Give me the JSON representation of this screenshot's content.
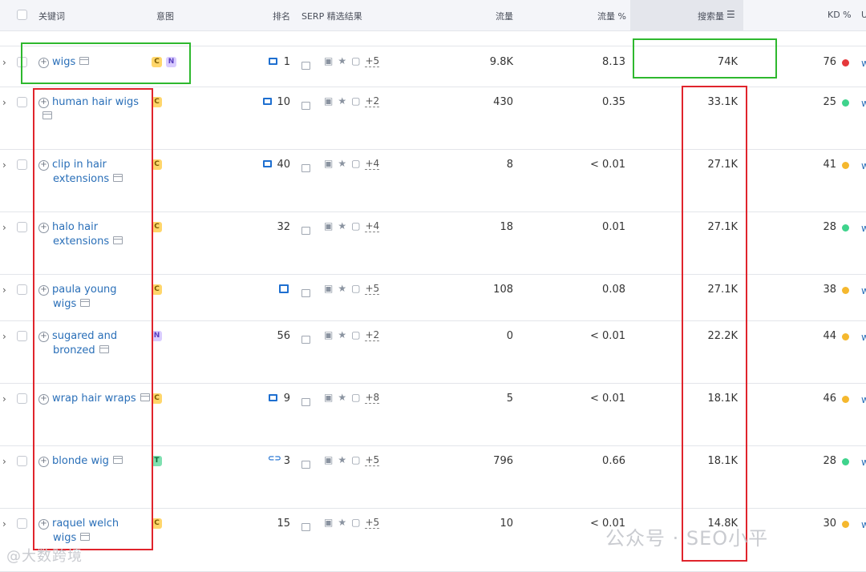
{
  "header": {
    "keyword": "关键词",
    "intent": "意图",
    "rank": "排名",
    "serp": "SERP 精选结果",
    "traffic": "流量",
    "traffic_pct": "流量 %",
    "volume": "搜索量",
    "kd": "KD %",
    "edge": "U"
  },
  "rows": [
    {
      "keyword_lines": [
        "wigs"
      ],
      "intents": [
        "C",
        "N"
      ],
      "rank": "1",
      "rank_icon": "image-pack-icon",
      "serp_more": "+5",
      "traffic": "9.8K",
      "traffic_pct": "8.13",
      "volume": "74K",
      "kd": "76",
      "kd_color": "#e5383b",
      "edge": "w"
    },
    {
      "keyword_lines": [
        "human hair wigs"
      ],
      "intents": [
        "C"
      ],
      "rank": "10",
      "rank_icon": "image-pack-icon",
      "serp_more": "+2",
      "traffic": "430",
      "traffic_pct": "0.35",
      "volume": "33.1K",
      "kd": "25",
      "kd_color": "#3fd38c",
      "edge": "w"
    },
    {
      "keyword_lines": [
        "clip in hair",
        "extensions"
      ],
      "intents": [
        "C"
      ],
      "rank": "40",
      "rank_icon": "image-pack-icon",
      "serp_more": "+4",
      "traffic": "8",
      "traffic_pct": "< 0.01",
      "volume": "27.1K",
      "kd": "41",
      "kd_color": "#f5b82e",
      "edge": "w"
    },
    {
      "keyword_lines": [
        "halo hair",
        "extensions"
      ],
      "intents": [
        "C"
      ],
      "rank": "32",
      "rank_icon": "",
      "serp_more": "+4",
      "traffic": "18",
      "traffic_pct": "0.01",
      "volume": "27.1K",
      "kd": "28",
      "kd_color": "#3fd38c",
      "edge": "w"
    },
    {
      "keyword_lines": [
        "paula young",
        "wigs"
      ],
      "intents": [
        "C"
      ],
      "rank": "",
      "rank_icon": "faq-icon",
      "serp_more": "+5",
      "traffic": "108",
      "traffic_pct": "0.08",
      "volume": "27.1K",
      "kd": "38",
      "kd_color": "#f5b82e",
      "edge": "w"
    },
    {
      "keyword_lines": [
        "sugared and",
        "bronzed"
      ],
      "intents": [
        "N"
      ],
      "rank": "56",
      "rank_icon": "",
      "serp_more": "+2",
      "traffic": "0",
      "traffic_pct": "< 0.01",
      "volume": "22.2K",
      "kd": "44",
      "kd_color": "#f5b82e",
      "edge": "w"
    },
    {
      "keyword_lines": [
        "wrap hair wraps"
      ],
      "intents": [
        "C"
      ],
      "rank": "9",
      "rank_icon": "image-pack-icon",
      "serp_more": "+8",
      "traffic": "5",
      "traffic_pct": "< 0.01",
      "volume": "18.1K",
      "kd": "46",
      "kd_color": "#f5b82e",
      "edge": "w"
    },
    {
      "keyword_lines": [
        "blonde wig"
      ],
      "intents": [
        "T"
      ],
      "rank": "3",
      "rank_icon": "link-icon",
      "serp_more": "+5",
      "traffic": "796",
      "traffic_pct": "0.66",
      "volume": "18.1K",
      "kd": "28",
      "kd_color": "#3fd38c",
      "edge": "w"
    },
    {
      "keyword_lines": [
        "raquel welch",
        "wigs"
      ],
      "intents": [
        "C"
      ],
      "rank": "15",
      "rank_icon": "",
      "serp_more": "+5",
      "traffic": "10",
      "traffic_pct": "< 0.01",
      "volume": "14.8K",
      "kd": "30",
      "kd_color": "#f5b82e",
      "edge": "w"
    }
  ],
  "watermark_right": "公众号 · SEO小平",
  "watermark_left": "@大数跨境"
}
